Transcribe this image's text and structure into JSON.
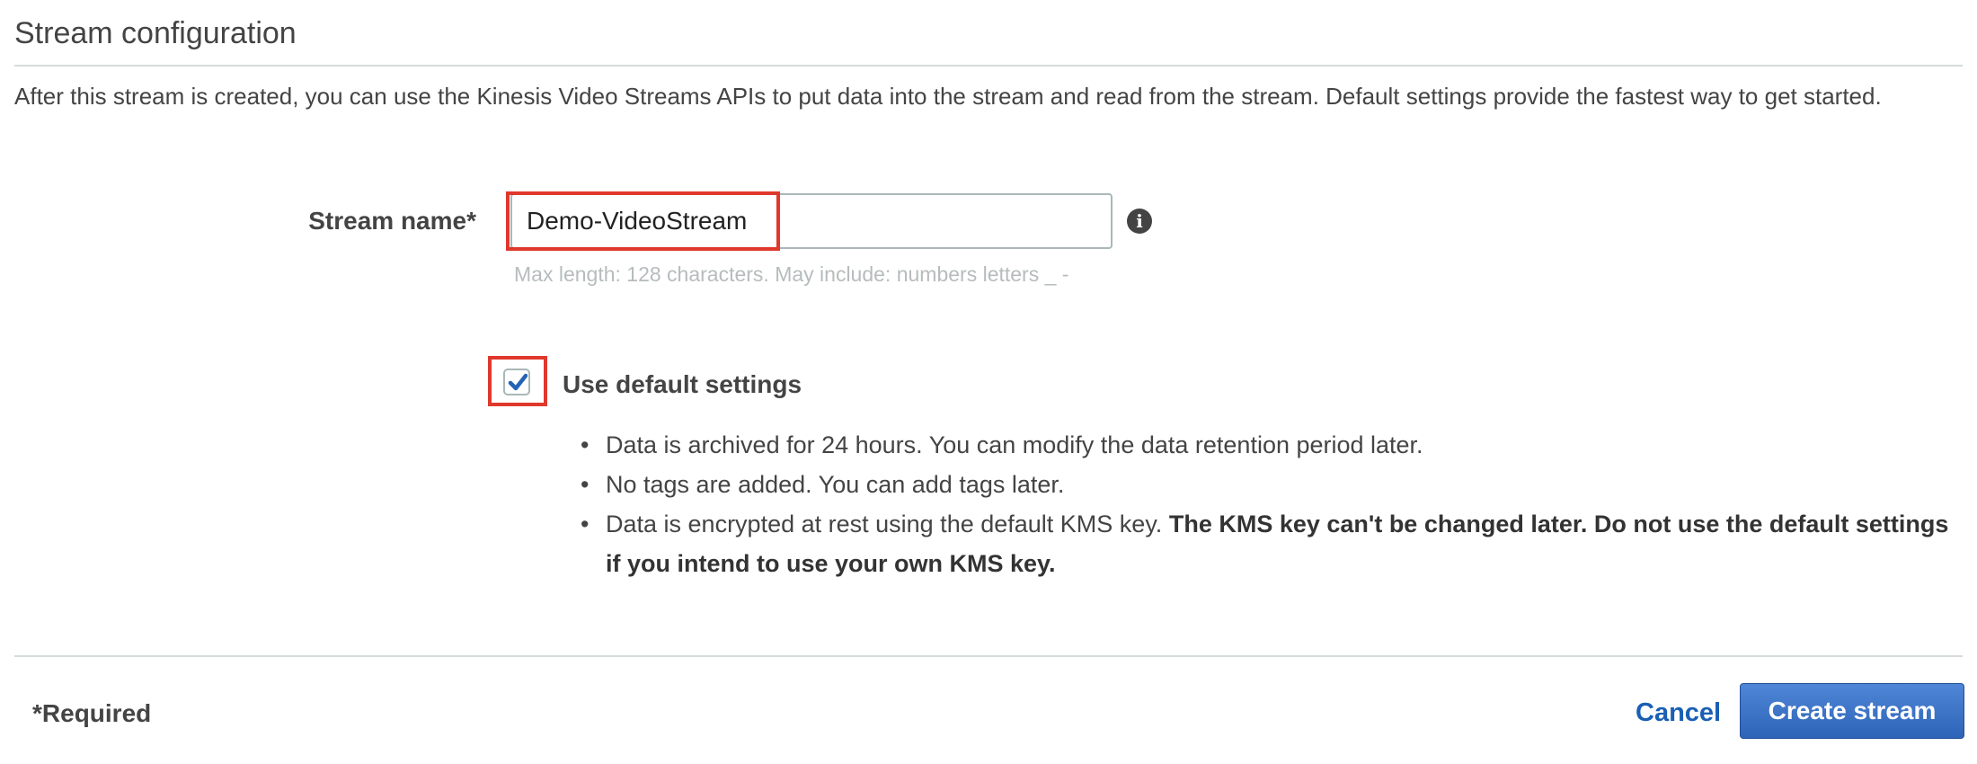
{
  "section": {
    "title": "Stream configuration",
    "description": "After this stream is created, you can use the Kinesis Video Streams APIs to put data into the stream and read from the stream. Default settings provide the fastest way to get started."
  },
  "stream_name": {
    "label": "Stream name*",
    "value": "Demo-VideoStream",
    "hint": "Max length: 128 characters. May include: numbers letters _ -",
    "info_icon": "info-icon"
  },
  "defaults": {
    "checkbox_label": "Use default settings",
    "checked": true,
    "bullets": [
      "Data is archived for 24 hours. You can modify the data retention period later.",
      "No tags are added. You can add tags later."
    ],
    "kms_bullet": {
      "text": "Data is encrypted at rest using the default KMS key. ",
      "bold_text": "The KMS key can't be changed later. Do not use the default settings if you intend to use your own KMS key."
    }
  },
  "footer": {
    "required_note": "*Required",
    "cancel_label": "Cancel",
    "create_label": "Create stream"
  },
  "colors": {
    "highlight": "#e0382d",
    "primary_button": "#2d64b8",
    "link": "#1a5fb4",
    "checkmark": "#2462b5"
  }
}
